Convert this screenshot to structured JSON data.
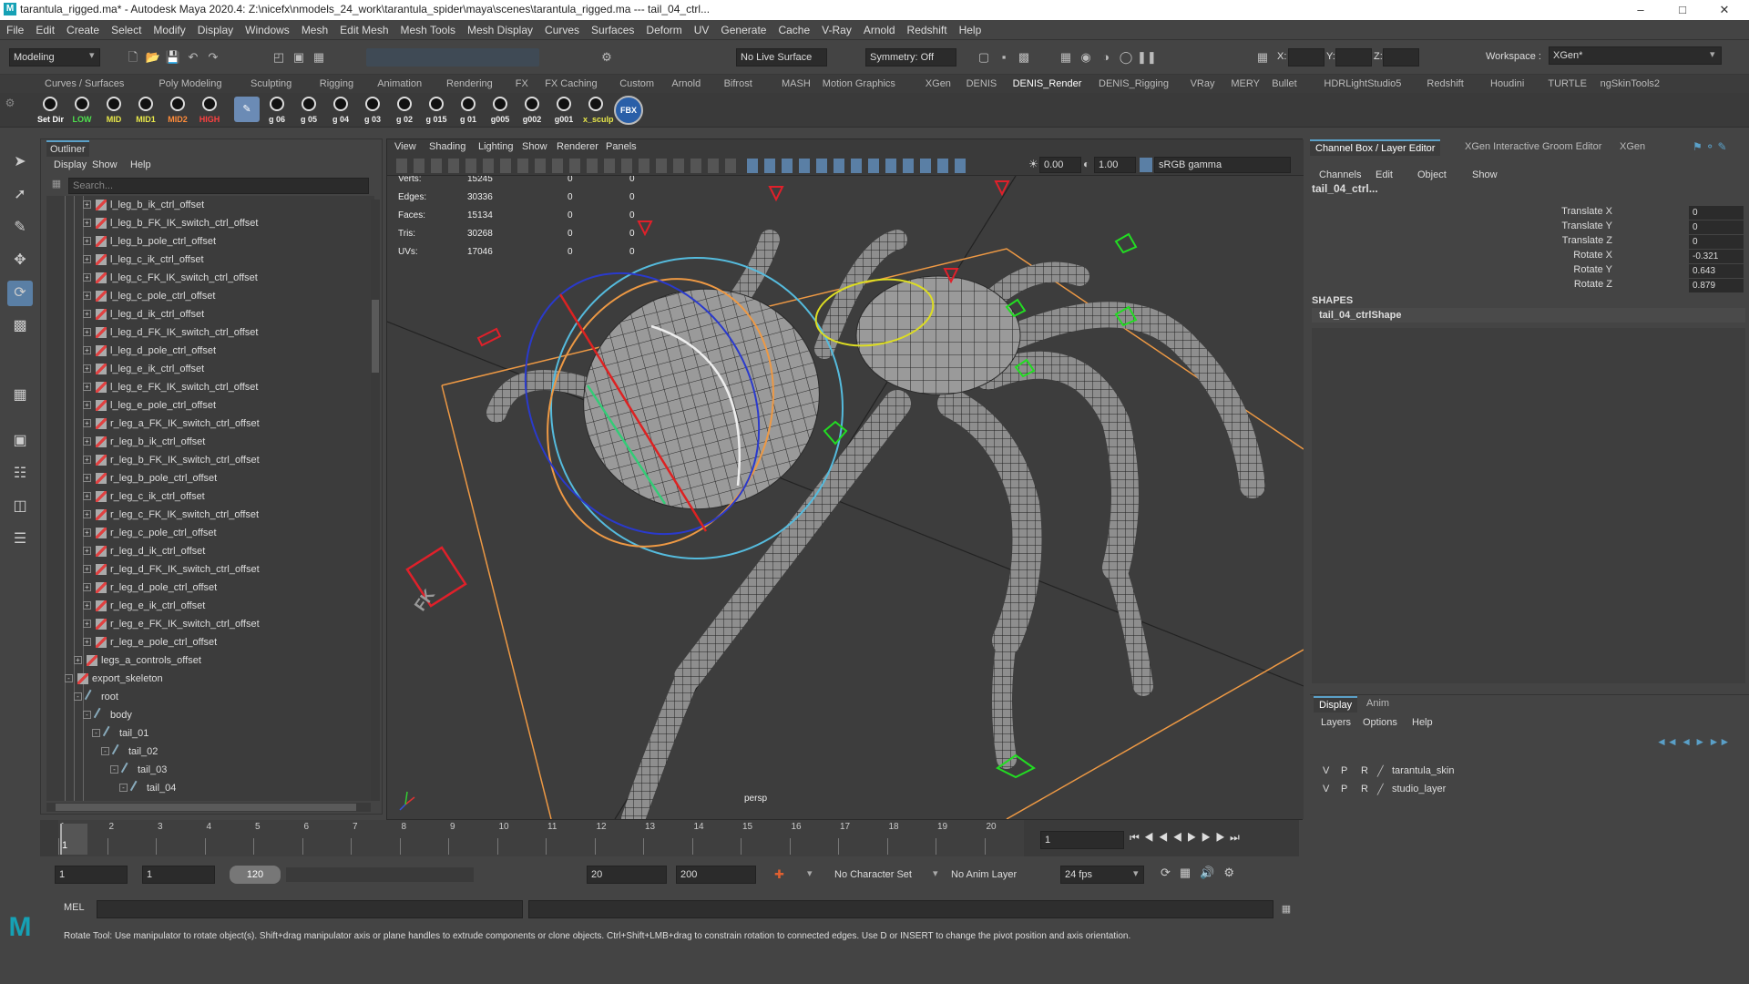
{
  "title": "tarantula_rigged.ma* - Autodesk Maya 2020.4: Z:\\nicefx\\nmodels_24_work\\tarantula_spider\\maya\\scenes\\tarantula_rigged.ma  ---  tail_04_ctrl...",
  "menu": [
    "File",
    "Edit",
    "Create",
    "Select",
    "Modify",
    "Display",
    "Windows",
    "Mesh",
    "Edit Mesh",
    "Mesh Tools",
    "Mesh Display",
    "Curves",
    "Surfaces",
    "Deform",
    "UV",
    "Generate",
    "Cache",
    "V-Ray",
    "Arnold",
    "Redshift",
    "Help"
  ],
  "status": {
    "mode": "Modeling",
    "live_surface": "No Live Surface",
    "symmetry": "Symmetry: Off",
    "x_label": "X:",
    "y_label": "Y:",
    "z_label": "Z:",
    "workspace_label": "Workspace :",
    "workspace": "XGen*"
  },
  "shelf_tabs": [
    "Curves / Surfaces",
    "Poly Modeling",
    "Sculpting",
    "Rigging",
    "Animation",
    "Rendering",
    "FX",
    "FX Caching",
    "Custom",
    "Arnold",
    "Bifrost",
    "MASH",
    "Motion Graphics",
    "XGen",
    "DENIS",
    "DENIS_Render",
    "DENIS_Rigging",
    "VRay",
    "MERY",
    "Bullet",
    "HDRLightStudio5",
    "Redshift",
    "Houdini",
    "TURTLE",
    "ngSkinTools2"
  ],
  "shelf_active": "DENIS_Render",
  "shelf_buttons": [
    {
      "label": "Set Dir",
      "color": "#ffffff"
    },
    {
      "label": "LOW",
      "color": "#4ee04e"
    },
    {
      "label": "MID",
      "color": "#e8e84a"
    },
    {
      "label": "MID1",
      "color": "#e8e84a"
    },
    {
      "label": "MID2",
      "color": "#ff8c3a"
    },
    {
      "label": "HIGH",
      "color": "#ff4040"
    }
  ],
  "shelf_buttons2": [
    "g 06",
    "g 05",
    "g 04",
    "g 03",
    "g 02",
    "g 015",
    "g 01",
    "g005",
    "g002",
    "g001",
    "x_sculp"
  ],
  "outliner": {
    "tab": "Outliner",
    "menu": [
      "Display",
      "Show",
      "Help"
    ],
    "search_placeholder": "Search...",
    "rows": [
      {
        "name": "l_leg_b_ik_ctrl_offset",
        "indent": 4,
        "type": "xf",
        "exp": "+"
      },
      {
        "name": "l_leg_b_FK_IK_switch_ctrl_offset",
        "indent": 4,
        "type": "xf",
        "exp": "+"
      },
      {
        "name": "l_leg_b_pole_ctrl_offset",
        "indent": 4,
        "type": "xf",
        "exp": "+"
      },
      {
        "name": "l_leg_c_ik_ctrl_offset",
        "indent": 4,
        "type": "xf",
        "exp": "+"
      },
      {
        "name": "l_leg_c_FK_IK_switch_ctrl_offset",
        "indent": 4,
        "type": "xf",
        "exp": "+"
      },
      {
        "name": "l_leg_c_pole_ctrl_offset",
        "indent": 4,
        "type": "xf",
        "exp": "+"
      },
      {
        "name": "l_leg_d_ik_ctrl_offset",
        "indent": 4,
        "type": "xf",
        "exp": "+"
      },
      {
        "name": "l_leg_d_FK_IK_switch_ctrl_offset",
        "indent": 4,
        "type": "xf",
        "exp": "+"
      },
      {
        "name": "l_leg_d_pole_ctrl_offset",
        "indent": 4,
        "type": "xf",
        "exp": "+"
      },
      {
        "name": "l_leg_e_ik_ctrl_offset",
        "indent": 4,
        "type": "xf",
        "exp": "+"
      },
      {
        "name": "l_leg_e_FK_IK_switch_ctrl_offset",
        "indent": 4,
        "type": "xf",
        "exp": "+"
      },
      {
        "name": "l_leg_e_pole_ctrl_offset",
        "indent": 4,
        "type": "xf",
        "exp": "+"
      },
      {
        "name": "r_leg_a_FK_IK_switch_ctrl_offset",
        "indent": 4,
        "type": "xf",
        "exp": "+"
      },
      {
        "name": "r_leg_b_ik_ctrl_offset",
        "indent": 4,
        "type": "xf",
        "exp": "+"
      },
      {
        "name": "r_leg_b_FK_IK_switch_ctrl_offset",
        "indent": 4,
        "type": "xf",
        "exp": "+"
      },
      {
        "name": "r_leg_b_pole_ctrl_offset",
        "indent": 4,
        "type": "xf",
        "exp": "+"
      },
      {
        "name": "r_leg_c_ik_ctrl_offset",
        "indent": 4,
        "type": "xf",
        "exp": "+"
      },
      {
        "name": "r_leg_c_FK_IK_switch_ctrl_offset",
        "indent": 4,
        "type": "xf",
        "exp": "+"
      },
      {
        "name": "r_leg_c_pole_ctrl_offset",
        "indent": 4,
        "type": "xf",
        "exp": "+"
      },
      {
        "name": "r_leg_d_ik_ctrl_offset",
        "indent": 4,
        "type": "xf",
        "exp": "+"
      },
      {
        "name": "r_leg_d_FK_IK_switch_ctrl_offset",
        "indent": 4,
        "type": "xf",
        "exp": "+"
      },
      {
        "name": "r_leg_d_pole_ctrl_offset",
        "indent": 4,
        "type": "xf",
        "exp": "+"
      },
      {
        "name": "r_leg_e_ik_ctrl_offset",
        "indent": 4,
        "type": "xf",
        "exp": "+"
      },
      {
        "name": "r_leg_e_FK_IK_switch_ctrl_offset",
        "indent": 4,
        "type": "xf",
        "exp": "+"
      },
      {
        "name": "r_leg_e_pole_ctrl_offset",
        "indent": 4,
        "type": "xf",
        "exp": "+"
      },
      {
        "name": "legs_a_controls_offset",
        "indent": 3,
        "type": "xf",
        "exp": "+"
      },
      {
        "name": "export_skeleton",
        "indent": 2,
        "type": "xf",
        "exp": "-"
      },
      {
        "name": "root",
        "indent": 3,
        "type": "jt",
        "exp": "-"
      },
      {
        "name": "body",
        "indent": 4,
        "type": "jt",
        "exp": "-"
      },
      {
        "name": "tail_01",
        "indent": 5,
        "type": "jt",
        "exp": "-"
      },
      {
        "name": "tail_02",
        "indent": 6,
        "type": "jt",
        "exp": "-"
      },
      {
        "name": "tail_03",
        "indent": 7,
        "type": "jt",
        "exp": "-"
      },
      {
        "name": "tail_04",
        "indent": 8,
        "type": "jt",
        "exp": "-"
      }
    ]
  },
  "viewport": {
    "menu": [
      "View",
      "Shading",
      "Lighting",
      "Show",
      "Renderer",
      "Panels"
    ],
    "exposure": "0.00",
    "gamma": "1.00",
    "colorspace": "sRGB gamma",
    "camera": "persp",
    "hud": [
      {
        "k": "Verts:",
        "a": "15245",
        "b": "0",
        "c": "0"
      },
      {
        "k": "Edges:",
        "a": "30336",
        "b": "0",
        "c": "0"
      },
      {
        "k": "Faces:",
        "a": "15134",
        "b": "0",
        "c": "0"
      },
      {
        "k": "Tris:",
        "a": "30268",
        "b": "0",
        "c": "0"
      },
      {
        "k": "UVs:",
        "a": "17046",
        "b": "0",
        "c": "0"
      }
    ]
  },
  "channelbox": {
    "tabs": [
      "Channel Box / Layer Editor",
      "XGen Interactive Groom Editor",
      "XGen"
    ],
    "menu": [
      "Channels",
      "Edit",
      "Object",
      "Show"
    ],
    "object": "tail_04_ctrl...",
    "attrs": [
      {
        "n": "Translate X",
        "v": "0"
      },
      {
        "n": "Translate Y",
        "v": "0"
      },
      {
        "n": "Translate Z",
        "v": "0"
      },
      {
        "n": "Rotate X",
        "v": "-0.321"
      },
      {
        "n": "Rotate Y",
        "v": "0.643"
      },
      {
        "n": "Rotate Z",
        "v": "0.879"
      }
    ],
    "shapes_label": "SHAPES",
    "shape": "tail_04_ctrlShape"
  },
  "layer_editor": {
    "tabs": [
      "Display",
      "Anim"
    ],
    "menu": [
      "Layers",
      "Options",
      "Help"
    ],
    "layers": [
      {
        "v": "V",
        "p": "P",
        "r": "R",
        "name": "tarantula_skin"
      },
      {
        "v": "V",
        "p": "P",
        "r": "R",
        "name": "studio_layer"
      }
    ]
  },
  "timeline": {
    "ticks": [
      "1",
      "2",
      "3",
      "4",
      "5",
      "6",
      "7",
      "8",
      "9",
      "10",
      "11",
      "12",
      "13",
      "14",
      "15",
      "16",
      "17",
      "18",
      "19",
      "20"
    ],
    "current_frame": "1",
    "current_field": "1"
  },
  "range": {
    "start": "1",
    "inner_start": "1",
    "range_label": "120",
    "inner_end": "20",
    "end": "200",
    "char_set": "No Character Set",
    "anim_layer": "No Anim Layer",
    "fps": "24 fps"
  },
  "cmd": {
    "label": "MEL"
  },
  "help_line": "Rotate Tool: Use manipulator to rotate object(s). Shift+drag manipulator axis or plane handles to extrude components or clone objects. Ctrl+Shift+LMB+drag to constrain rotation to connected edges. Use D or INSERT to change the pivot position and axis orientation.",
  "colors": {
    "accent": "#5aa0c8",
    "panel": "#444444",
    "field": "#2b2b2b",
    "rig_red": "#e0202a",
    "rig_green": "#22dd22",
    "rig_yellow": "#dddd22",
    "rig_orange": "#ee9944",
    "rig_cyan": "#55bbdd"
  }
}
